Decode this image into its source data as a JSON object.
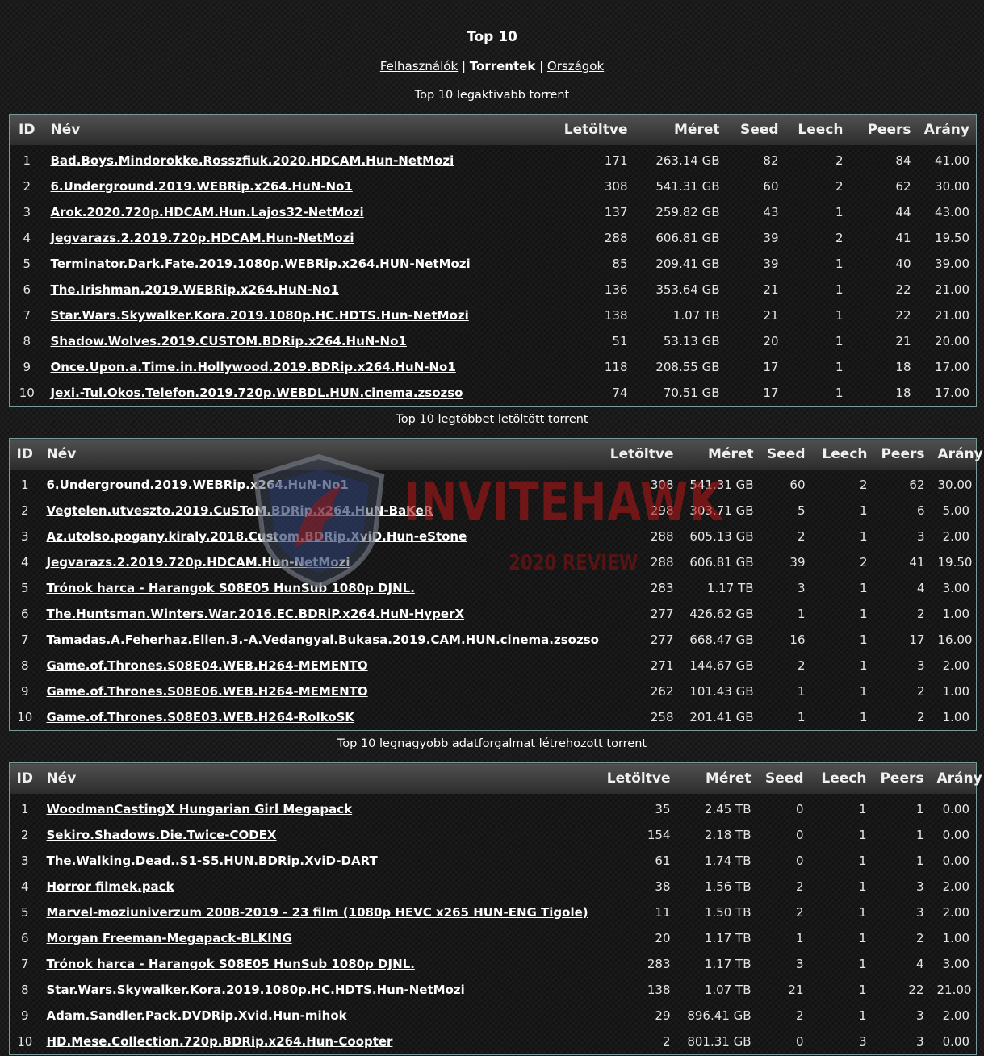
{
  "page": {
    "title": "Top 10"
  },
  "nav": {
    "users": "Felhasználók",
    "torrents": "Torrentek",
    "countries": "Országok",
    "separator": "|"
  },
  "watermark": {
    "text": "INVITEHAWK",
    "sub": "2020 REVIEW"
  },
  "colors": {
    "ratio_good": "#3ee63e",
    "ratio_bad": "#e02020",
    "border": "#7a9a9a"
  },
  "sections": [
    {
      "caption": "Top 10 legaktivabb torrent",
      "headers": {
        "id": "ID",
        "name": "Név",
        "downloaded": "Letöltve",
        "size": "Méret",
        "seed": "Seed",
        "leech": "Leech",
        "peers": "Peers",
        "ratio": "Arány"
      },
      "rows": [
        {
          "id": "1",
          "name": "Bad.Boys.Mindorokke.Rosszfiuk.2020.HDCAM.Hun-NetMozi",
          "downloaded": "171",
          "size": "263.14 GB",
          "seed": "82",
          "leech": "2",
          "peers": "84",
          "ratio": "41.00"
        },
        {
          "id": "2",
          "name": "6.Underground.2019.WEBRip.x264.HuN-No1",
          "downloaded": "308",
          "size": "541.31 GB",
          "seed": "60",
          "leech": "2",
          "peers": "62",
          "ratio": "30.00"
        },
        {
          "id": "3",
          "name": "Arok.2020.720p.HDCAM.Hun.Lajos32-NetMozi",
          "downloaded": "137",
          "size": "259.82 GB",
          "seed": "43",
          "leech": "1",
          "peers": "44",
          "ratio": "43.00"
        },
        {
          "id": "4",
          "name": "Jegvarazs.2.2019.720p.HDCAM.Hun-NetMozi",
          "downloaded": "288",
          "size": "606.81 GB",
          "seed": "39",
          "leech": "2",
          "peers": "41",
          "ratio": "19.50"
        },
        {
          "id": "5",
          "name": "Terminator.Dark.Fate.2019.1080p.WEBRip.x264.HUN-NetMozi",
          "downloaded": "85",
          "size": "209.41 GB",
          "seed": "39",
          "leech": "1",
          "peers": "40",
          "ratio": "39.00"
        },
        {
          "id": "6",
          "name": "The.Irishman.2019.WEBRip.x264.HuN-No1",
          "downloaded": "136",
          "size": "353.64 GB",
          "seed": "21",
          "leech": "1",
          "peers": "22",
          "ratio": "21.00"
        },
        {
          "id": "7",
          "name": "Star.Wars.Skywalker.Kora.2019.1080p.HC.HDTS.Hun-NetMozi",
          "downloaded": "138",
          "size": "1.07 TB",
          "seed": "21",
          "leech": "1",
          "peers": "22",
          "ratio": "21.00"
        },
        {
          "id": "8",
          "name": "Shadow.Wolves.2019.CUSTOM.BDRip.x264.HuN-No1",
          "downloaded": "51",
          "size": "53.13 GB",
          "seed": "20",
          "leech": "1",
          "peers": "21",
          "ratio": "20.00"
        },
        {
          "id": "9",
          "name": "Once.Upon.a.Time.in.Hollywood.2019.BDRip.x264.HuN-No1",
          "downloaded": "118",
          "size": "208.55 GB",
          "seed": "17",
          "leech": "1",
          "peers": "18",
          "ratio": "17.00"
        },
        {
          "id": "10",
          "name": "Jexi.-Tul.Okos.Telefon.2019.720p.WEBDL.HUN.cinema.zsozso",
          "downloaded": "74",
          "size": "70.51 GB",
          "seed": "17",
          "leech": "1",
          "peers": "18",
          "ratio": "17.00"
        }
      ]
    },
    {
      "caption": "Top 10 legtöbbet letöltött torrent",
      "headers": {
        "id": "ID",
        "name": "Név",
        "downloaded": "Letöltve",
        "size": "Méret",
        "seed": "Seed",
        "leech": "Leech",
        "peers": "Peers",
        "ratio": "Arány"
      },
      "rows": [
        {
          "id": "1",
          "name": "6.Underground.2019.WEBRip.x264.HuN-No1",
          "downloaded": "308",
          "size": "541.31 GB",
          "seed": "60",
          "leech": "2",
          "peers": "62",
          "ratio": "30.00"
        },
        {
          "id": "2",
          "name": "Vegtelen.utveszto.2019.CuSToM.BDRip.x264.HuN-BaKeR",
          "downloaded": "298",
          "size": "303.71 GB",
          "seed": "5",
          "leech": "1",
          "peers": "6",
          "ratio": "5.00"
        },
        {
          "id": "3",
          "name": "Az.utolso.pogany.kiraly.2018.Custom.BDRip.XviD.Hun-eStone",
          "downloaded": "288",
          "size": "605.13 GB",
          "seed": "2",
          "leech": "1",
          "peers": "3",
          "ratio": "2.00"
        },
        {
          "id": "4",
          "name": "Jegvarazs.2.2019.720p.HDCAM.Hun-NetMozi",
          "downloaded": "288",
          "size": "606.81 GB",
          "seed": "39",
          "leech": "2",
          "peers": "41",
          "ratio": "19.50"
        },
        {
          "id": "5",
          "name": "Trónok harca - Harangok S08E05 HunSub 1080p DJNL.",
          "downloaded": "283",
          "size": "1.17 TB",
          "seed": "3",
          "leech": "1",
          "peers": "4",
          "ratio": "3.00"
        },
        {
          "id": "6",
          "name": "The.Huntsman.Winters.War.2016.EC.BDRiP.x264.HuN-HyperX",
          "downloaded": "277",
          "size": "426.62 GB",
          "seed": "1",
          "leech": "1",
          "peers": "2",
          "ratio": "1.00"
        },
        {
          "id": "7",
          "name": "Tamadas.A.Feherhaz.Ellen.3.-A.Vedangyal.Bukasa.2019.CAM.HUN.cinema.zsozso",
          "downloaded": "277",
          "size": "668.47 GB",
          "seed": "16",
          "leech": "1",
          "peers": "17",
          "ratio": "16.00"
        },
        {
          "id": "8",
          "name": "Game.of.Thrones.S08E04.WEB.H264-MEMENTO",
          "downloaded": "271",
          "size": "144.67 GB",
          "seed": "2",
          "leech": "1",
          "peers": "3",
          "ratio": "2.00"
        },
        {
          "id": "9",
          "name": "Game.of.Thrones.S08E06.WEB.H264-MEMENTO",
          "downloaded": "262",
          "size": "101.43 GB",
          "seed": "1",
          "leech": "1",
          "peers": "2",
          "ratio": "1.00"
        },
        {
          "id": "10",
          "name": "Game.of.Thrones.S08E03.WEB.H264-RolkoSK",
          "downloaded": "258",
          "size": "201.41 GB",
          "seed": "1",
          "leech": "1",
          "peers": "2",
          "ratio": "1.00"
        }
      ]
    },
    {
      "caption": "Top 10 legnagyobb adatforgalmat létrehozott torrent",
      "headers": {
        "id": "ID",
        "name": "Név",
        "downloaded": "Letöltve",
        "size": "Méret",
        "seed": "Seed",
        "leech": "Leech",
        "peers": "Peers",
        "ratio": "Arány"
      },
      "rows": [
        {
          "id": "1",
          "name": "WoodmanCastingX Hungarian Girl Megapack",
          "downloaded": "35",
          "size": "2.45 TB",
          "seed": "0",
          "leech": "1",
          "peers": "1",
          "ratio": "0.00"
        },
        {
          "id": "2",
          "name": "Sekiro.Shadows.Die.Twice-CODEX",
          "downloaded": "154",
          "size": "2.18 TB",
          "seed": "0",
          "leech": "1",
          "peers": "1",
          "ratio": "0.00"
        },
        {
          "id": "3",
          "name": "The.Walking.Dead..S1-S5.HUN.BDRip.XviD-DART",
          "downloaded": "61",
          "size": "1.74 TB",
          "seed": "0",
          "leech": "1",
          "peers": "1",
          "ratio": "0.00"
        },
        {
          "id": "4",
          "name": "Horror filmek.pack",
          "downloaded": "38",
          "size": "1.56 TB",
          "seed": "2",
          "leech": "1",
          "peers": "3",
          "ratio": "2.00"
        },
        {
          "id": "5",
          "name": "Marvel-moziuniverzum 2008-2019 - 23 film (1080p HEVC x265 HUN-ENG Tigole)",
          "downloaded": "11",
          "size": "1.50 TB",
          "seed": "2",
          "leech": "1",
          "peers": "3",
          "ratio": "2.00"
        },
        {
          "id": "6",
          "name": "Morgan Freeman-Megapack-BLKING",
          "downloaded": "20",
          "size": "1.17 TB",
          "seed": "1",
          "leech": "1",
          "peers": "2",
          "ratio": "1.00"
        },
        {
          "id": "7",
          "name": "Trónok harca - Harangok S08E05 HunSub 1080p DJNL.",
          "downloaded": "283",
          "size": "1.17 TB",
          "seed": "3",
          "leech": "1",
          "peers": "4",
          "ratio": "3.00"
        },
        {
          "id": "8",
          "name": "Star.Wars.Skywalker.Kora.2019.1080p.HC.HDTS.Hun-NetMozi",
          "downloaded": "138",
          "size": "1.07 TB",
          "seed": "21",
          "leech": "1",
          "peers": "22",
          "ratio": "21.00"
        },
        {
          "id": "9",
          "name": "Adam.Sandler.Pack.DVDRip.Xvid.Hun-mihok",
          "downloaded": "29",
          "size": "896.41 GB",
          "seed": "2",
          "leech": "1",
          "peers": "3",
          "ratio": "2.00"
        },
        {
          "id": "10",
          "name": "HD.Mese.Collection.720p.BDRip.x264.Hun-Coopter",
          "downloaded": "2",
          "size": "801.31 GB",
          "seed": "0",
          "leech": "3",
          "peers": "3",
          "ratio": "0.00"
        }
      ]
    }
  ]
}
